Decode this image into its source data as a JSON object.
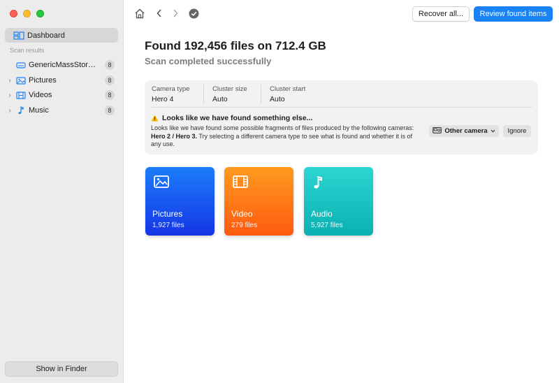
{
  "sidebar": {
    "dashboard_label": "Dashboard",
    "section_label": "Scan results",
    "items": [
      {
        "label": "GenericMassStora...",
        "count": "8",
        "icon": "drive-icon"
      },
      {
        "label": "Pictures",
        "count": "8",
        "icon": "photo-icon"
      },
      {
        "label": "Videos",
        "count": "8",
        "icon": "film-icon"
      },
      {
        "label": "Music",
        "count": "8",
        "icon": "music-note-icon"
      }
    ],
    "finder_button": "Show in Finder"
  },
  "toolbar": {
    "recover_all": "Recover all...",
    "review_found": "Review found items"
  },
  "main": {
    "title": "Found 192,456 files on 712.4 GB",
    "subtitle": "Scan completed successfully"
  },
  "panel": {
    "camera_type_label": "Camera type",
    "camera_type_value": "Hero 4",
    "cluster_size_label": "Cluster size",
    "cluster_size_value": "Auto",
    "cluster_start_label": "Cluster start",
    "cluster_start_value": "Auto",
    "warning_title": "Looks like we have found something else...",
    "warning_text_1": "Looks like we have found some possible fragments of files produced by the following cameras: ",
    "warning_cameras": "Hero 2 / Hero 3.",
    "warning_text_2": " Try selecting a different camera type to see what is found and whether it is of any use.",
    "other_camera": "Other camera",
    "ignore": "Ignore"
  },
  "cards": [
    {
      "name": "Pictures",
      "count": "1,927 files"
    },
    {
      "name": "Video",
      "count": "279 files"
    },
    {
      "name": "Audio",
      "count": "5,927 files"
    }
  ],
  "colors": {
    "accent": "#1a82f7",
    "pictures": "#1c5cf0",
    "video": "#ff7a18",
    "audio": "#1cc3c3"
  }
}
